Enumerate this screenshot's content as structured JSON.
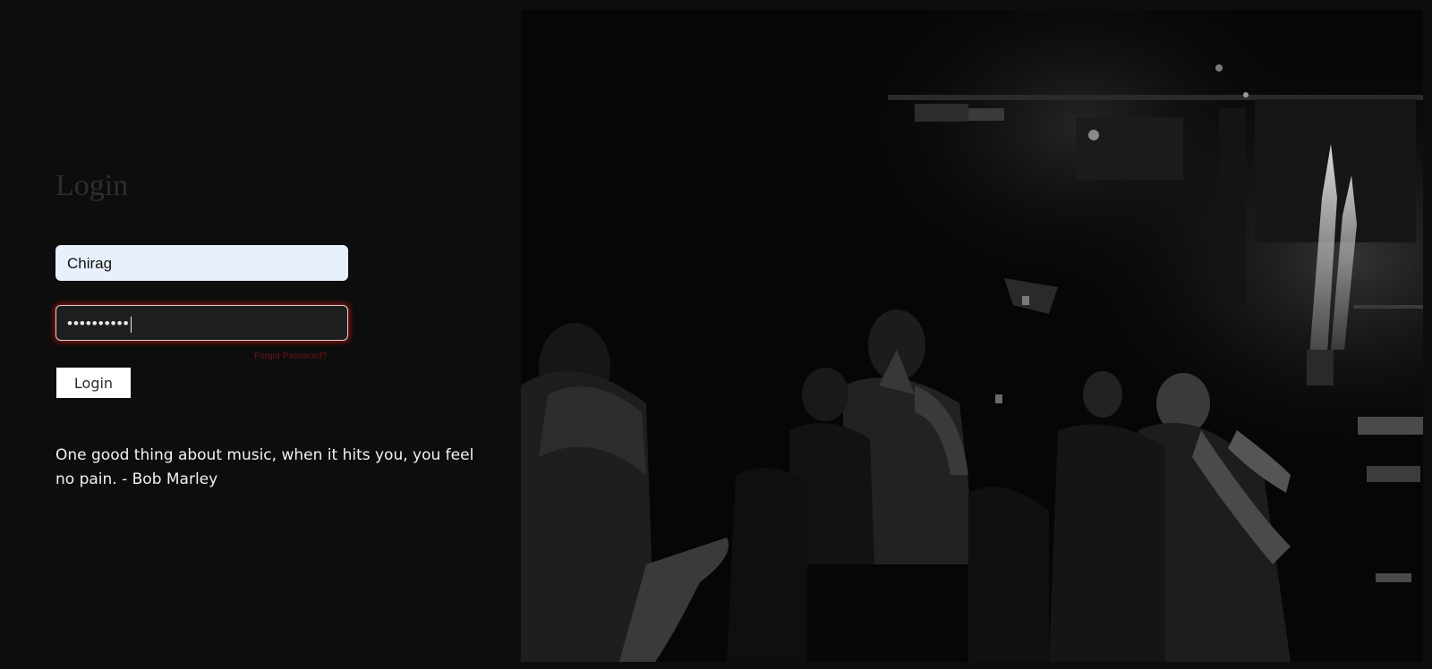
{
  "login": {
    "title": "Login",
    "username_value": "Chirag",
    "password_masked": "••••••••••",
    "forgot_password": "Forgot Password?",
    "login_button": "Login",
    "quote": "One good thing about music, when it hits you, you feel no pain. - Bob Marley"
  },
  "colors": {
    "background": "#0d0d0d",
    "username_bg": "#e8f0fe",
    "password_glow": "#b41414",
    "forgot_link": "#6e1414"
  },
  "hero": {
    "icon": "nightclub-crowd-photo"
  }
}
